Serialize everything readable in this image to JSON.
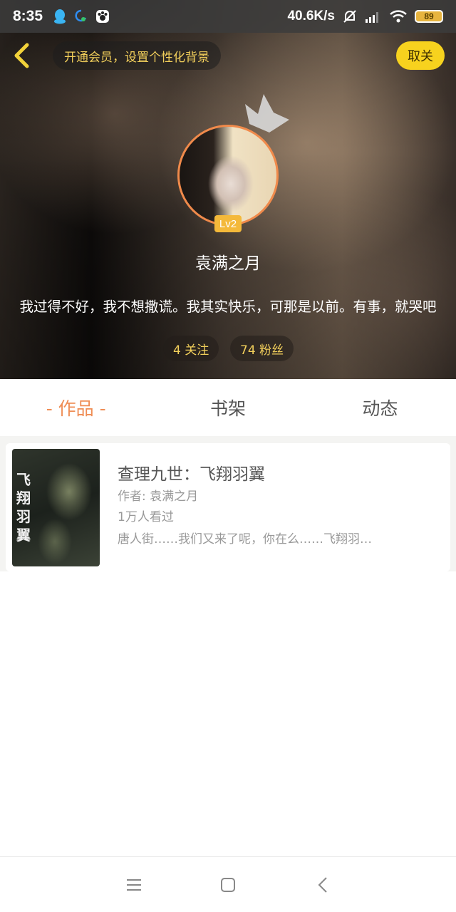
{
  "status_bar": {
    "time": "8:35",
    "network_speed": "40.6K/s",
    "battery": "89",
    "icons": [
      "qq-icon",
      "wechat-like-icon",
      "paw-app-icon",
      "mute-bell-icon",
      "signal-icon",
      "wifi-icon",
      "battery-icon"
    ]
  },
  "header": {
    "vip_prompt": "开通会员，设置个性化背景",
    "follow_button": "取关",
    "level": "Lv2",
    "username": "袁满之月",
    "bio": "我过得不好，我不想撒谎。我其实快乐，可那是以前。有事，就哭吧",
    "stats": {
      "following": "4 关注",
      "fans": "74 粉丝"
    }
  },
  "tabs": [
    {
      "label": "- 作品 -",
      "active": true
    },
    {
      "label": "书架",
      "active": false
    },
    {
      "label": "动态",
      "active": false
    }
  ],
  "works": [
    {
      "title": "查理九世：飞翔羽翼",
      "author": "作者: 袁满之月",
      "views": "1万人看过",
      "description": "唐人街……我们又来了呢，你在么……飞翔羽…",
      "cover_text": "飞翔羽翼"
    }
  ],
  "colors": {
    "accent_orange": "#ef8d55",
    "follow_yellow": "#f7d21e",
    "vip_gold": "#f2cf5b",
    "avatar_ring": "#f08a4b"
  }
}
